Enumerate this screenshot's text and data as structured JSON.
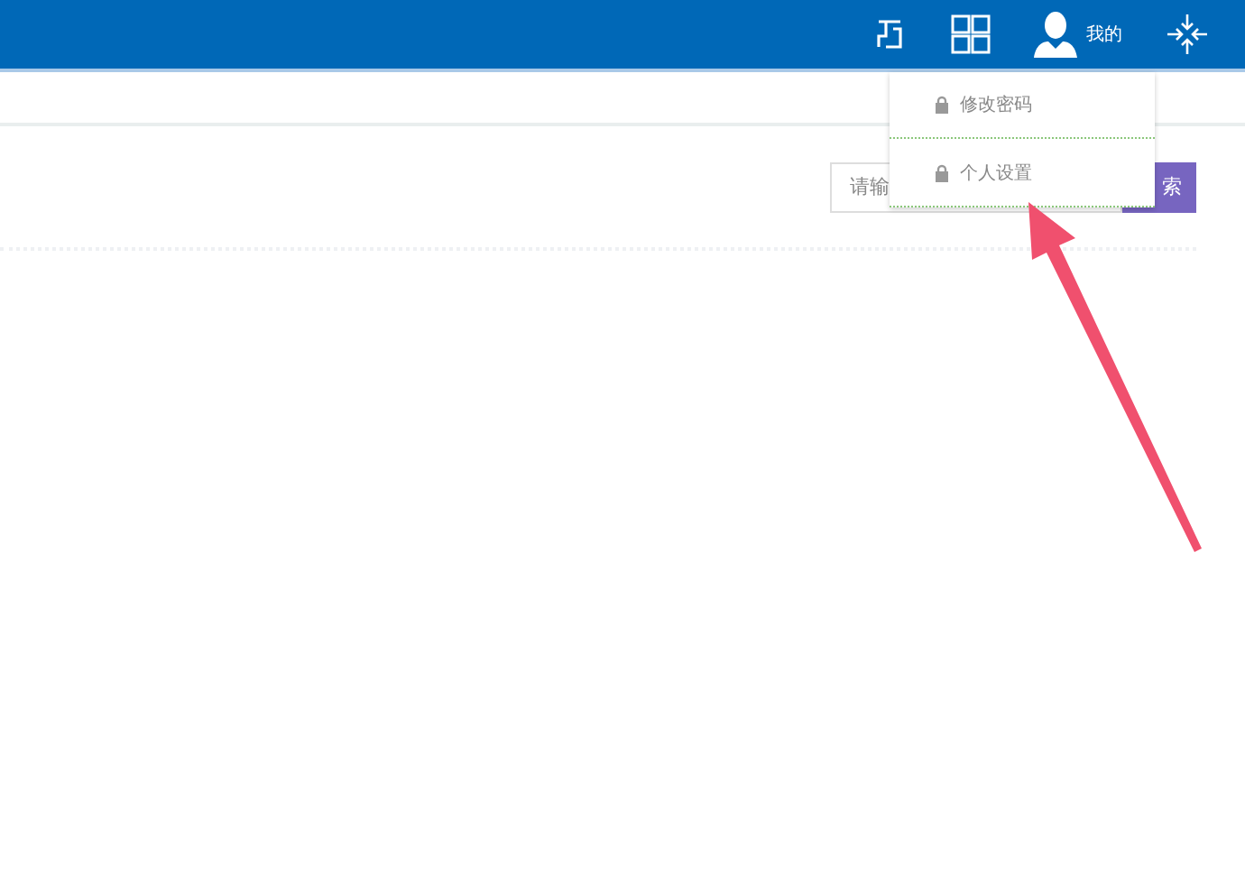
{
  "header": {
    "user_label": "我的"
  },
  "search": {
    "placeholder": "请输",
    "button": "索"
  },
  "user_menu": {
    "items": [
      {
        "label": "修改密码"
      },
      {
        "label": "个人设置"
      }
    ]
  }
}
